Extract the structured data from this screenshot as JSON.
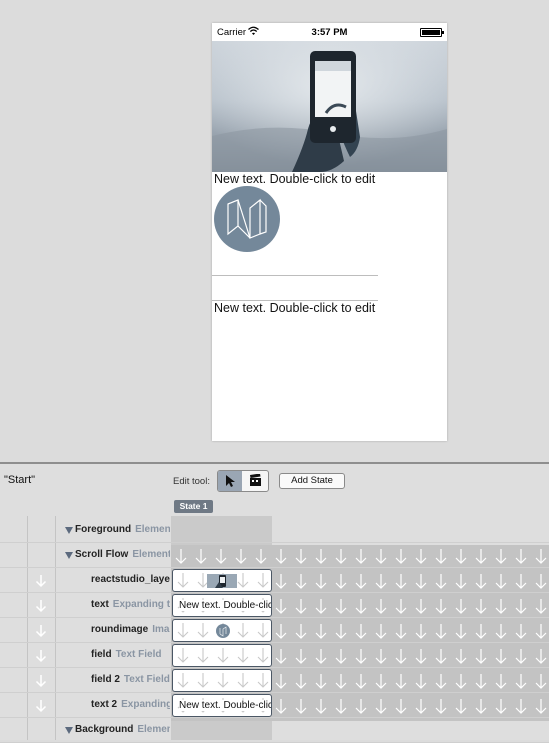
{
  "phone": {
    "carrier": "Carrier",
    "time": "3:57 PM",
    "text1": "New text. Double-click to edit",
    "text2": "New text. Double-click to edit",
    "wifi_icon": "wifi-icon",
    "battery_icon": "battery-icon"
  },
  "panel": {
    "state_name": "\"Start\"",
    "edit_tool_label": "Edit tool:",
    "add_state_label": "Add State",
    "state_tab": "State 1"
  },
  "rows": [
    {
      "name": "Foreground",
      "kind": "Element",
      "cell": null
    },
    {
      "name": "Scroll Flow",
      "kind": "Element",
      "cell": null
    },
    {
      "name": "reactstudio_layer",
      "kind": "Image",
      "cell": "image"
    },
    {
      "name": "text",
      "kind": "Expanding text",
      "cell": "New text. Double-click to edit"
    },
    {
      "name": "roundimage",
      "kind": "Image",
      "cell": "round"
    },
    {
      "name": "field",
      "kind": "Text Field",
      "cell": ""
    },
    {
      "name": "field 2",
      "kind": "Text Field",
      "cell": ""
    },
    {
      "name": "text 2",
      "kind": "Expanding text",
      "cell": "New text. Double-click to edit"
    },
    {
      "name": "Background",
      "kind": "Element",
      "cell": null
    }
  ],
  "colors": {
    "accent": "#6f7985",
    "cell_border": "#4b5765",
    "avatar": "#74889a"
  }
}
